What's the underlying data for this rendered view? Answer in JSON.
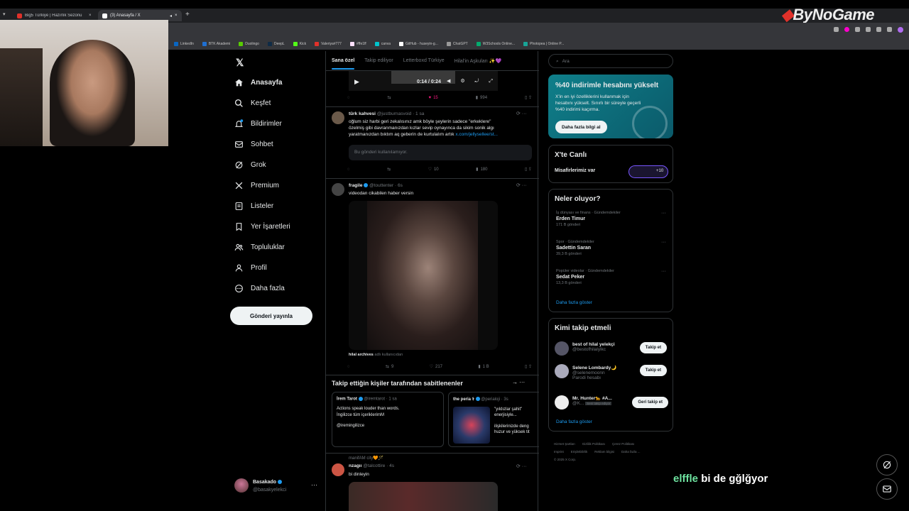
{
  "browser": {
    "tabs": [
      {
        "title": "Big5 Türkiye | Hazırlık Sezonu",
        "color": "#e0312a"
      },
      {
        "title": "(3) Anasayfa / X",
        "color": "#ffffff"
      }
    ],
    "bookmarks": [
      "LinkedIn",
      "BTK Akademi",
      "Duolingo",
      "DeepL",
      "Kick",
      "Valeriya#777",
      "#ffe1ff",
      "canva",
      "GitHub - huseyin-g...",
      "ChatGPT",
      "W3Schools Online...",
      "Photopea | Online P..."
    ]
  },
  "watermark": {
    "brand_a": "ByNoGame"
  },
  "nav": {
    "items": [
      {
        "label": "Anasayfa",
        "icon": "home-icon"
      },
      {
        "label": "Keşfet",
        "icon": "search-icon"
      },
      {
        "label": "Bildirimler",
        "icon": "bell-icon"
      },
      {
        "label": "Sohbet",
        "icon": "mail-icon"
      },
      {
        "label": "Grok",
        "icon": "grok-icon"
      },
      {
        "label": "Premium",
        "icon": "x-icon"
      },
      {
        "label": "Listeler",
        "icon": "list-icon"
      },
      {
        "label": "Yer İşaretleri",
        "icon": "bookmark-icon"
      },
      {
        "label": "Topluluklar",
        "icon": "people-icon"
      },
      {
        "label": "Profil",
        "icon": "person-icon"
      },
      {
        "label": "Daha fazla",
        "icon": "more-icon"
      }
    ],
    "post_button": "Gönderi yayınla"
  },
  "profile": {
    "name": "Basakado",
    "handle": "@basakyelekci"
  },
  "feed": {
    "tabs": [
      "Sana özel",
      "Takip ediliyor",
      "Letterboxd Türkiye",
      "Hilal'in Aşkuları ✨💜"
    ],
    "video_time": "0:14 / 0:24",
    "first_actions": {
      "likes": "15",
      "views": "994"
    },
    "tweet1": {
      "name": "türk kahvesi",
      "handle": "@justburnasvoid · 1 sa",
      "text1": "oğlum siz harbi geri zekalısınız amk böyle şeylerin sadece \"erkeklere\"",
      "text2": "özelmiş gibi davranmanızdan kızlar sevip oynayınca da sikim sonik algı",
      "text3": "yaratmanızdan bıktım aq geberin de kurtulalım artık",
      "link": "x.com/jellysellee/st...",
      "quote": "Bu gönderi kullanılamıyor.",
      "likes": "10",
      "views": "180"
    },
    "tweet2": {
      "name": "fragile",
      "handle": "@touttenter · 6s",
      "text": "videodan cikabilen haber versin",
      "source_name": "hilal archives",
      "source_suffix": "adlı kullanıcıdan",
      "retweets": "9",
      "likes": "217",
      "views": "1 B"
    },
    "pinned_title": "Takip ettiğin kişiler tarafından sabitlenenler",
    "pinned": [
      {
        "name": "İrem Tarot",
        "handle": "@iremtarot · 1 sa",
        "line1": "Actions speak louder than words.",
        "line2": "İngilizce tüm içeriklerimM",
        "line3": "@iremingilizce"
      },
      {
        "name": "the peria ⚕",
        "handle": "@perialoji · 3s",
        "line1": "\"yıldızlar şahit\"",
        "line2": "enerjisiyle...",
        "line3": "ilişkilerinizde deng",
        "line4": "huzur ve yüksek tit"
      }
    ],
    "tweet3": {
      "context": "manifAM city🧡🪄",
      "name": "nzagıı",
      "handle": "@talcottire · 4s",
      "text": "bi dinleyin"
    }
  },
  "sidebar": {
    "search_placeholder": "Ara",
    "promo": {
      "title": "%40 indirimle hesabını yükselt",
      "body1": "X'in en iyi özelliklerini kullanmak için",
      "body2": "hesabını yükselt. Sınırlı bir süreyle geçerli",
      "body3": "%40 indirimi kaçırma.",
      "button": "Daha fazla bilgi al"
    },
    "live": {
      "title": "X'te Canlı",
      "text": "Misafirlerimiz var",
      "count": "+10"
    },
    "trends": {
      "title": "Neler oluyor?",
      "items": [
        {
          "category": "İş dünyası ve finans · Gündemdekiler",
          "name": "Erden Timur",
          "count": "171 B gönderi"
        },
        {
          "category": "Spor · Gündemdekiler",
          "name": "Sadettin Saran",
          "count": "39,3 B gönderi"
        },
        {
          "category": "Popüler videolar · Gündemdekiler",
          "name": "Sedat Peker",
          "count": "13,3 B gönderi"
        }
      ],
      "more": "Daha fazla göster"
    },
    "who_to_follow": {
      "title": "Kimi takip etmeli",
      "items": [
        {
          "name": "best of hilal yelekçi",
          "handle": "@bestofhilalylkc",
          "sub": "",
          "button": "Takip et"
        },
        {
          "name": "Selene Lombardy🌙",
          "handle": "@selenemoonn",
          "sub": "Parodi hesabı",
          "button": "Takip et"
        },
        {
          "name": "Mr. Hunter🐆 #A...",
          "handle": "@K...",
          "sub": "Seni takip ediyor",
          "button": "Geri takip et"
        }
      ],
      "more": "Daha fazla göster"
    },
    "footer": {
      "line1": [
        "Hizmet Şartları",
        "Gizlilik Politikası",
        "Çerez Politikası"
      ],
      "line2": [
        "Imprint",
        "Erişilebilirlik",
        "Reklam bilgisi",
        "Daha fazla ..."
      ],
      "copyright": "© 2025 X Corp."
    }
  },
  "caption": {
    "highlight": "elffle",
    "rest": "bi de gğlğyor"
  }
}
